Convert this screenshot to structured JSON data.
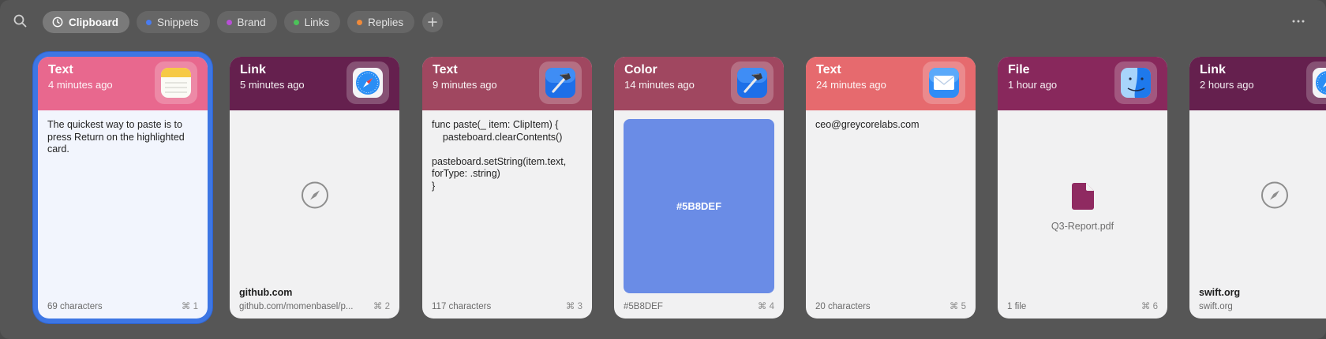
{
  "toolbar": {
    "tabs": [
      {
        "label": "Clipboard",
        "active": true,
        "icon": "clock-icon"
      },
      {
        "label": "Snippets",
        "dot_color": "#4a7cf0"
      },
      {
        "label": "Brand",
        "dot_color": "#b84fd6"
      },
      {
        "label": "Links",
        "dot_color": "#4cc259"
      },
      {
        "label": "Replies",
        "dot_color": "#f08a3a"
      }
    ],
    "add_icon": "plus-icon",
    "search_icon": "search-icon",
    "more_icon": "ellipsis-icon"
  },
  "cards": [
    {
      "type": "Text",
      "time": "4 minutes ago",
      "app_icon": "notes-app-icon",
      "header_color": "#e8688e",
      "selected": true,
      "body": "The quickest way to paste is to press Return on the highlighted card.",
      "footer_left": "69 characters",
      "shortcut": "⌘ 1"
    },
    {
      "type": "Link",
      "time": "5 minutes ago",
      "app_icon": "safari-app-icon",
      "header_color": "#65204e",
      "domain": "github.com",
      "footer_left": "github.com/momenbasel/p...",
      "shortcut": "⌘ 2"
    },
    {
      "type": "Text",
      "time": "9 minutes ago",
      "app_icon": "xcode-app-icon",
      "header_color": "#a04760",
      "body": "func paste(_ item: ClipItem) {\n    pasteboard.clearContents()\n\npasteboard.setString(item.text, forType: .string)\n}",
      "footer_left": "117 characters",
      "shortcut": "⌘ 3"
    },
    {
      "type": "Color",
      "time": "14 minutes ago",
      "app_icon": "xcode-app-icon",
      "header_color": "#a04760",
      "swatch_color": "#5B8DEF",
      "swatch_label": "#5B8DEF",
      "footer_left": "#5B8DEF",
      "shortcut": "⌘ 4"
    },
    {
      "type": "Text",
      "time": "24 minutes ago",
      "app_icon": "mail-app-icon",
      "header_color": "#e66a6e",
      "body": "ceo@greycorelabs.com",
      "footer_left": "20 characters",
      "shortcut": "⌘ 5"
    },
    {
      "type": "File",
      "time": "1 hour ago",
      "app_icon": "finder-app-icon",
      "header_color": "#88285c",
      "file_name": "Q3-Report.pdf",
      "footer_left": "1 file",
      "shortcut": "⌘ 6"
    },
    {
      "type": "Link",
      "time": "2 hours ago",
      "app_icon": "safari-app-icon",
      "header_color": "#65204e",
      "domain": "swift.org",
      "footer_left": "swift.org"
    }
  ]
}
